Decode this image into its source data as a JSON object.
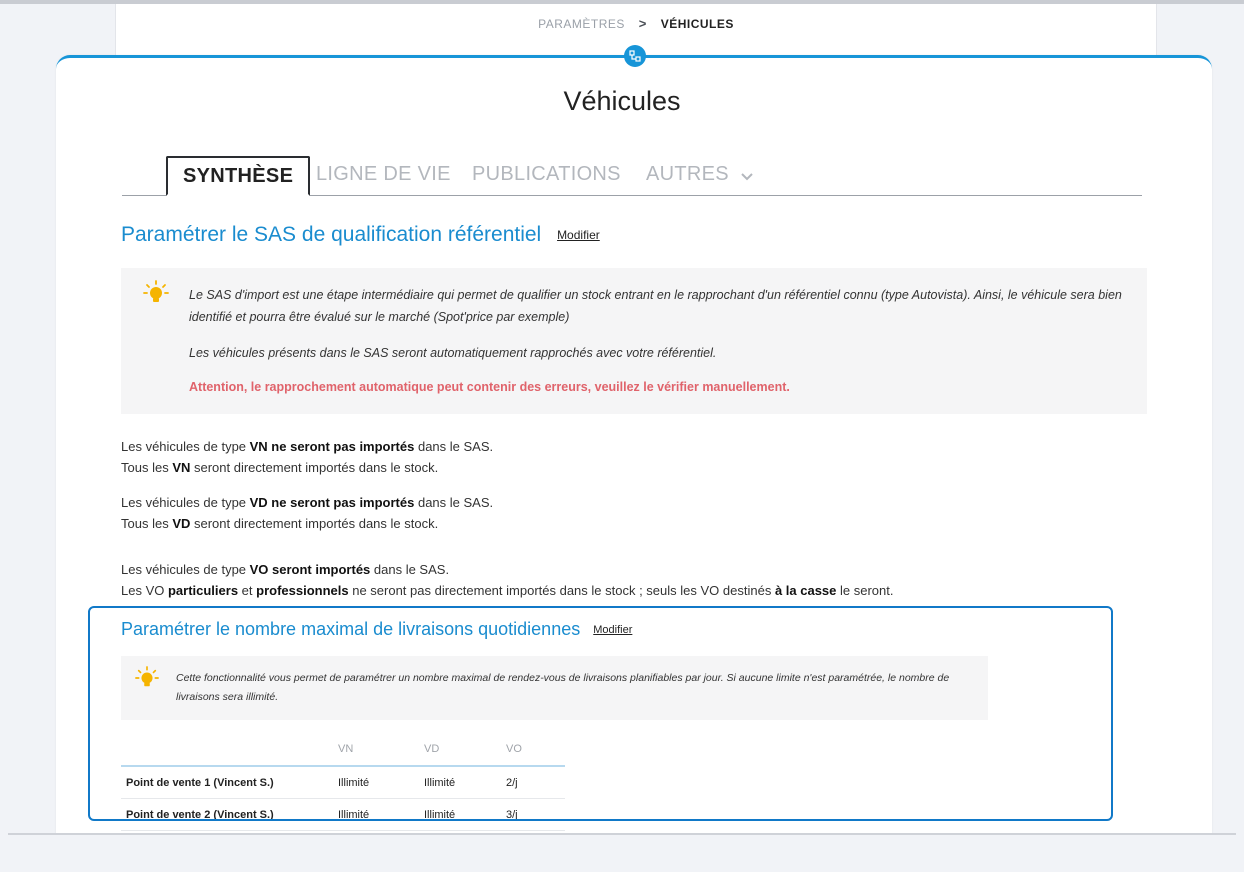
{
  "breadcrumb": {
    "parent": "PARAMÈTRES",
    "separator": ">",
    "current": "VÉHICULES"
  },
  "page": {
    "title": "Véhicules"
  },
  "tabs": [
    {
      "label": "SYNTHÈSE",
      "active": true
    },
    {
      "label": "LIGNE DE VIE",
      "active": false
    },
    {
      "label": "PUBLICATIONS",
      "active": false
    },
    {
      "label": "AUTRES",
      "active": false
    }
  ],
  "sas": {
    "title": "Paramétrer le SAS de qualification référentiel",
    "modify": "Modifier",
    "info_1": "Le SAS d'import est une étape intermédiaire qui permet de qualifier un stock entrant en le rapprochant d'un référentiel connu (type Autovista). Ainsi, le véhicule sera bien identifié et pourra être évalué sur le marché (Spot'price par exemple)",
    "info_2": "Les véhicules présents dans le SAS seront automatiquement rapprochés avec votre référentiel.",
    "warning": "Attention, le rapprochement automatique peut contenir des erreurs, veuillez le vérifier manuellement."
  },
  "rules": {
    "vn": {
      "l1_a": "Les véhicules de type ",
      "l1_b": "VN ne seront pas importés",
      "l1_c": " dans le SAS.",
      "l2_a": "Tous les ",
      "l2_b": "VN",
      "l2_c": " seront directement importés dans le stock."
    },
    "vd": {
      "l1_a": "Les véhicules de type ",
      "l1_b": "VD ne seront pas importés",
      "l1_c": " dans le SAS.",
      "l2_a": "Tous les ",
      "l2_b": "VD",
      "l2_c": " seront directement importés dans le stock."
    },
    "vo": {
      "l1_a": "Les véhicules de type ",
      "l1_b": "VO seront importés",
      "l1_c": " dans le SAS.",
      "l2_a": "Les VO ",
      "l2_b": "particuliers",
      "l2_c": " et ",
      "l2_d": "professionnels",
      "l2_e": " ne seront pas directement importés dans le stock ; seuls les VO destinés ",
      "l2_f": "à la casse",
      "l2_g": " le seront."
    }
  },
  "deliveries": {
    "title": "Paramétrer le nombre maximal de livraisons quotidiennes",
    "modify": "Modifier",
    "info": "Cette fonctionnalité vous permet de paramétrer un nombre maximal de rendez-vous de livraisons planifiables par jour. Si aucune limite n'est paramétrée, le nombre de livraisons sera illimité.",
    "columns": [
      "",
      "VN",
      "VD",
      "VO"
    ],
    "rows": [
      {
        "name": "Point de vente 1 (Vincent S.)",
        "vn": "Illimité",
        "vd": "Illimité",
        "vo": "2/j"
      },
      {
        "name": "Point de vente 2 (Vincent S.)",
        "vn": "Illimité",
        "vd": "Illimité",
        "vo": "3/j"
      }
    ]
  },
  "colors": {
    "accent": "#1795d8",
    "title_blue": "#1a8ccf",
    "warning_red": "#e0636b",
    "highlight_border": "#1179c8"
  },
  "icons": {
    "header": "network-icon",
    "tip": "lightbulb-icon",
    "dropdown": "chevron-down-icon"
  }
}
